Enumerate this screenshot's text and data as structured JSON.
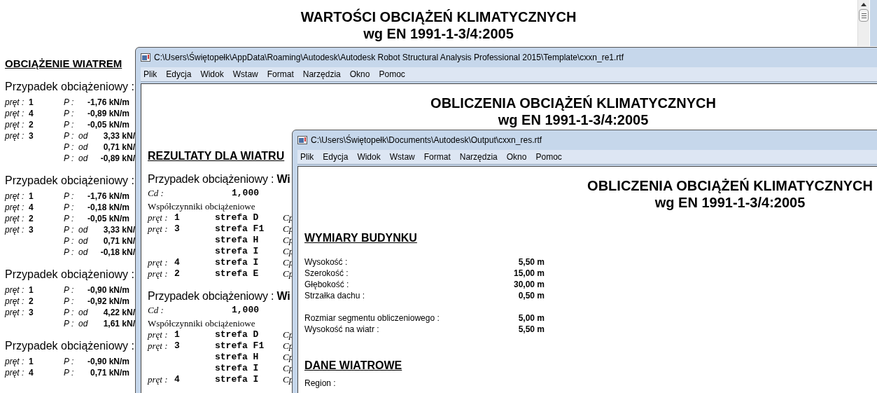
{
  "background_document": {
    "title_lines": [
      "WARTOŚCI OBCIĄŻEŃ KLIMATYCZNYCH",
      "wg EN 1991-1-3/4:2005"
    ],
    "section": "OBCIĄŻENIE WIATREM",
    "load_cases": [
      {
        "label": "Przypadek obciążeniowy :",
        "rows": [
          {
            "member_label": "pręt :",
            "member": "1",
            "p_label": "P :",
            "value": "-1,76 kN/m"
          },
          {
            "member_label": "pręt :",
            "member": "4",
            "p_label": "P :",
            "value": "-0,89 kN/m"
          },
          {
            "member_label": "pręt :",
            "member": "2",
            "p_label": "P :",
            "value": "-0,05 kN/m"
          },
          {
            "member_label": "pręt :",
            "member": "3",
            "p_label": "P :",
            "qualifier": "od",
            "value": "3,33 kN/"
          },
          {
            "p_label": "P :",
            "qualifier": "od",
            "value": "0,71 kN/"
          },
          {
            "p_label": "P :",
            "qualifier": "od",
            "value": "-0,89 kN/"
          }
        ]
      },
      {
        "label": "Przypadek obciążeniowy :",
        "rows": [
          {
            "member_label": "pręt :",
            "member": "1",
            "p_label": "P :",
            "value": "-1,76 kN/m"
          },
          {
            "member_label": "pręt :",
            "member": "4",
            "p_label": "P :",
            "value": "-0,18 kN/m"
          },
          {
            "member_label": "pręt :",
            "member": "2",
            "p_label": "P :",
            "value": "-0,05 kN/m"
          },
          {
            "member_label": "pręt :",
            "member": "3",
            "p_label": "P :",
            "qualifier": "od",
            "value": "3,33 kN/"
          },
          {
            "p_label": "P :",
            "qualifier": "od",
            "value": "0,71 kN/"
          },
          {
            "p_label": "P :",
            "qualifier": "od",
            "value": "-0,18 kN/"
          }
        ]
      },
      {
        "label": "Przypadek obciążeniowy :",
        "rows": [
          {
            "member_label": "pręt :",
            "member": "1",
            "p_label": "P :",
            "value": "-0,90 kN/m"
          },
          {
            "member_label": "pręt :",
            "member": "2",
            "p_label": "P :",
            "value": "-0,92 kN/m"
          },
          {
            "member_label": "pręt :",
            "member": "3",
            "p_label": "P :",
            "qualifier": "od",
            "value": "4,22 kN/"
          },
          {
            "p_label": "P :",
            "qualifier": "od",
            "value": "1,61 kN/"
          }
        ]
      },
      {
        "label": "Przypadek obciążeniowy :",
        "rows": [
          {
            "member_label": "pręt :",
            "member": "1",
            "p_label": "P :",
            "value": "-0,90 kN/m"
          },
          {
            "member_label": "pręt :",
            "member": "4",
            "p_label": "P :",
            "value": "0,71 kN/m"
          }
        ]
      }
    ]
  },
  "windows": [
    {
      "title": "C:\\Users\\Świętopełk\\AppData\\Roaming\\Autodesk\\Autodesk Robot Structural Analysis Professional 2015\\Template\\cxxn_re1.rtf",
      "menu": [
        "Plik",
        "Edycja",
        "Widok",
        "Wstaw",
        "Format",
        "Narzędzia",
        "Okno",
        "Pomoc"
      ],
      "document": {
        "kind": "results",
        "title_lines": [
          "OBLICZENIA OBCIĄŻEŃ KLIMATYCZNYCH",
          "wg EN 1991-1-3/4:2005"
        ],
        "section": "REZULTATY DLA WIATRU",
        "cases": [
          {
            "label": "Przypadek obciążeniowy :",
            "name": "Wi",
            "cd_label": "Cd :",
            "cd": "1,000",
            "coef_heading": "Współczynniki obciążeniowe",
            "rows": [
              {
                "member_label": "pręt :",
                "member": "1",
                "zone": "strefa D",
                "cp": "Cp"
              },
              {
                "member_label": "pręt :",
                "member": "3",
                "zone": "strefa F1",
                "cp": "Cp"
              },
              {
                "zone": "strefa H",
                "cp": "Cp"
              },
              {
                "zone": "strefa I",
                "cp": "Cp"
              },
              {
                "member_label": "pręt :",
                "member": "4",
                "zone": "strefa I",
                "cp": "Cp"
              },
              {
                "member_label": "pręt :",
                "member": "2",
                "zone": "strefa E",
                "cp": "Cp"
              }
            ]
          },
          {
            "label": "Przypadek obciążeniowy :",
            "name": "Wi",
            "cd_label": "Cd :",
            "cd": "1,000",
            "coef_heading": "Współczynniki obciążeniowe",
            "rows": [
              {
                "member_label": "pręt :",
                "member": "1",
                "zone": "strefa D",
                "cp": "Cp"
              },
              {
                "member_label": "pręt :",
                "member": "3",
                "zone": "strefa F1",
                "cp": "Cp"
              },
              {
                "zone": "strefa H",
                "cp": "Cp"
              },
              {
                "zone": "strefa I",
                "cp": "Cp"
              },
              {
                "member_label": "pręt :",
                "member": "4",
                "zone": "strefa I",
                "cp": "Cp"
              }
            ]
          }
        ]
      }
    },
    {
      "title": "C:\\Users\\Świętopełk\\Documents\\Autodesk\\Output\\cxxn_res.rtf",
      "menu": [
        "Plik",
        "Edycja",
        "Widok",
        "Wstaw",
        "Format",
        "Narzędzia",
        "Okno",
        "Pomoc"
      ],
      "document": {
        "kind": "dimensions",
        "title_lines": [
          "OBLICZENIA OBCIĄŻEŃ KLIMATYCZNYCH",
          "wg EN 1991-1-3/4:2005"
        ],
        "sections": [
          {
            "heading": "WYMIARY BUDYNKU",
            "groups": [
              [
                {
                  "label": "Wysokość :",
                  "value": "5,50 m"
                },
                {
                  "label": "Szerokość :",
                  "value": "15,00 m"
                },
                {
                  "label": "Głębokość :",
                  "value": "30,00 m"
                },
                {
                  "label": "Strzałka dachu :",
                  "value": "0,50 m"
                }
              ],
              [
                {
                  "label": "Rozmiar segmentu obliczeniowego :",
                  "value": "5,00 m"
                },
                {
                  "label": "Wysokość na wiatr :",
                  "value": "5,50 m"
                }
              ]
            ]
          },
          {
            "heading": "DANE WIATROWE",
            "groups": [
              [
                {
                  "label": "Region :"
                }
              ]
            ]
          }
        ]
      }
    }
  ]
}
